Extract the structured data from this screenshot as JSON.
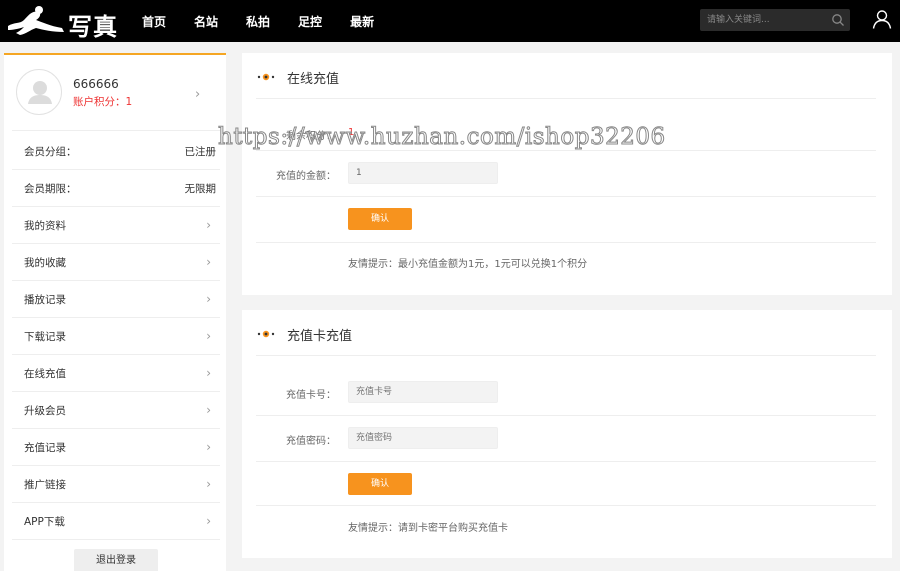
{
  "header": {
    "logo_text": "写真",
    "nav": [
      "首页",
      "名站",
      "私拍",
      "足控",
      "最新"
    ],
    "search_placeholder": "请输入关键词..."
  },
  "sidebar": {
    "username": "666666",
    "points": "账户积分：1",
    "info_rows": [
      {
        "label": "会员分组：",
        "value": "已注册"
      },
      {
        "label": "会员期限：",
        "value": "无限期"
      }
    ],
    "menu": [
      "我的资料",
      "我的收藏",
      "播放记录",
      "下载记录",
      "在线充值",
      "升级会员",
      "充值记录",
      "推广链接",
      "APP下载"
    ],
    "logout": "退出登录"
  },
  "recharge": {
    "title": "在线充值",
    "balance_label": "剩余积分：",
    "balance_value": "1",
    "amount_label": "充值的金额：",
    "amount_value": "1",
    "confirm": "确认",
    "tip": "友情提示：最小充值金额为1元，1元可以兑换1个积分"
  },
  "card": {
    "title": "充值卡充值",
    "card_no_label": "充值卡号：",
    "card_no_placeholder": "充值卡号",
    "card_pwd_label": "充值密码：",
    "card_pwd_placeholder": "充值密码",
    "confirm": "确认",
    "tip": "友情提示：请到卡密平台购买充值卡"
  },
  "watermark": "https://www.huzhan.com/ishop32206",
  "colors": {
    "accent": "#f7931e",
    "points_red": "#e33333",
    "header_bg": "#000000"
  }
}
